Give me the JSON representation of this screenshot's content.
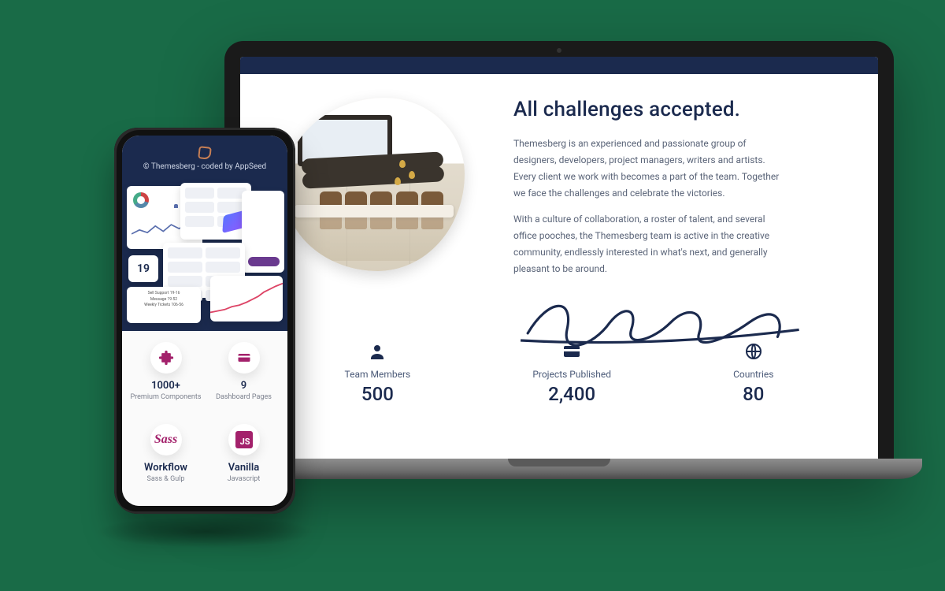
{
  "laptop": {
    "heading": "All challenges accepted.",
    "para1": "Themesberg is an experienced and passionate group of designers, developers, project managers, writers and artists. Every client we work with becomes a part of the team. Together we face the challenges and celebrate the victories.",
    "para2": "With a culture of collaboration, a roster of talent, and several office pooches, the Themesberg team is active in the creative community, endlessly interested in what's next, and generally pleasant to be around.",
    "stats": [
      {
        "icon": "user-icon",
        "label": "Team Members",
        "value": "500"
      },
      {
        "icon": "card-icon",
        "label": "Projects Published",
        "value": "2,400"
      },
      {
        "icon": "globe-icon",
        "label": "Countries",
        "value": "80"
      }
    ]
  },
  "phone": {
    "credit": "© Themesberg - coded by AppSeed",
    "collage_number": "19",
    "mini_lines": [
      "Sell Support 19-16",
      "Message 19-52",
      "Weekly Tickets 106-56"
    ],
    "features": [
      {
        "icon": "puzzle-icon",
        "title": "1000+",
        "sub": "Premium Components"
      },
      {
        "icon": "card-icon",
        "title": "9",
        "sub": "Dashboard Pages"
      },
      {
        "icon": "sass-icon",
        "title": "Workflow",
        "sub": "Sass & Gulp"
      },
      {
        "icon": "js-icon",
        "title": "Vanilla",
        "sub": "Javascript"
      }
    ]
  }
}
